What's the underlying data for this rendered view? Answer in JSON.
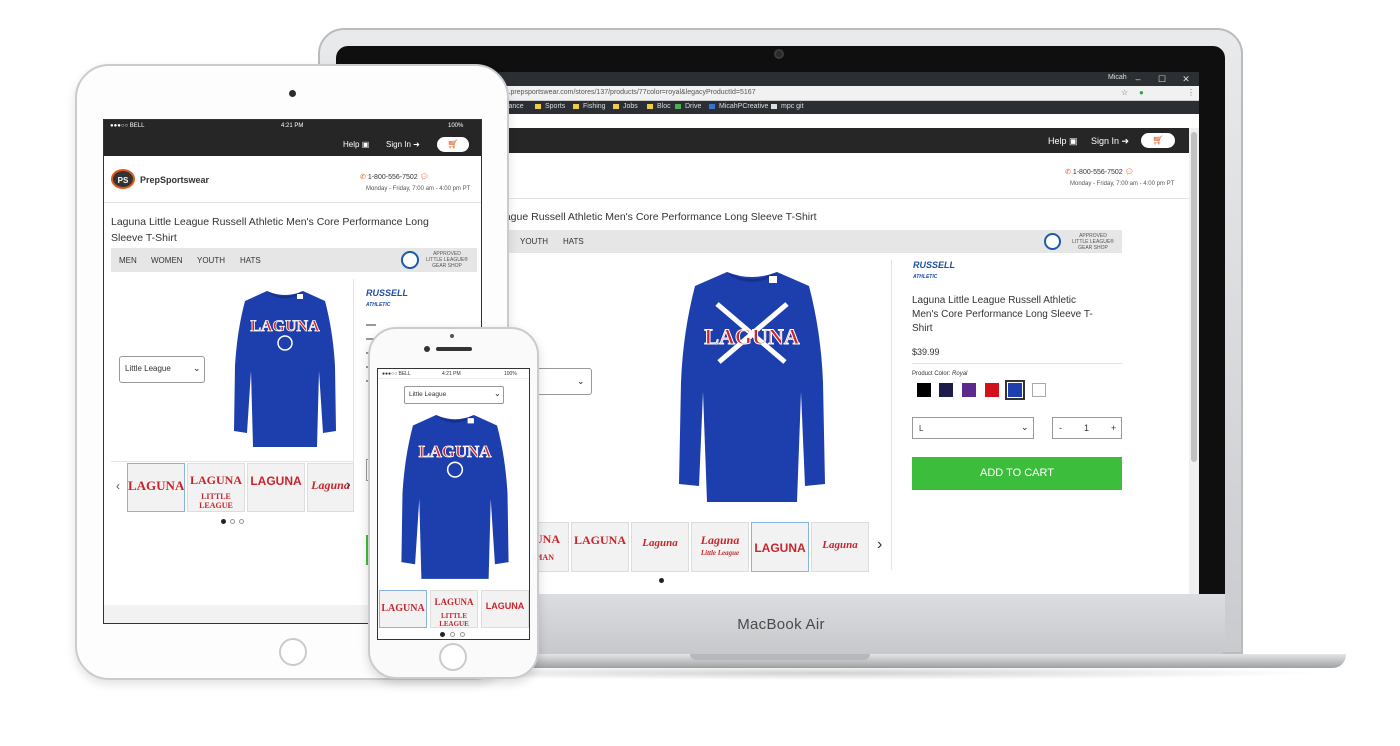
{
  "laptop": {
    "brand_text": "MacBook Air",
    "window": {
      "user": "Micah",
      "minimize": "–",
      "maximize": "☐",
      "close": "✕"
    },
    "address": "s.prepsportswear.com/stores/137/products/77color=royal&legacyProductId=5167",
    "bookmarks": [
      "elance",
      "Sports",
      "Fishing",
      "Jobs",
      "Bloc",
      "Drive",
      "MicahPCreative",
      "mpc git"
    ],
    "site": {
      "help": "Help",
      "sign_in": "Sign In",
      "phone": "1-800-556-7502",
      "hours": "Monday - Friday, 7:00 am - 4:00 pm PT",
      "page_title": "eague Russell Athletic Men's Core Performance Long Sleeve T-Shirt",
      "nav": [
        "YOUTH",
        "HATS"
      ],
      "badge": [
        "APPROVED",
        "LITTLE LEAGUE®",
        "GEAR SHOP"
      ],
      "brand_logo": "RUSSELL",
      "brand_logo_sub": "ATHLETIC",
      "product_title": [
        "Laguna Little League Russell Athletic",
        "Men's Core Performance Long Sleeve T-",
        "Shirt"
      ],
      "price": "$39.99",
      "color_label": "Product Color:",
      "color_value": "Royal",
      "swatches": [
        "#000000",
        "#1b1c4a",
        "#5b2a8c",
        "#d1121b",
        "#1e3fae",
        "#ffffff"
      ],
      "size": "L",
      "qty_minus": "-",
      "qty_value": "1",
      "qty_plus": "+",
      "add_to_cart": "ADD TO CART",
      "shirt_text": "LAGUNA",
      "thumbs": [
        "LAGUNA",
        "LAGUNA",
        "Laguna",
        "Laguna",
        "LAGUNA",
        "Laguna"
      ],
      "thumb_subs": [
        "BASEMAN",
        "",
        "",
        "Little League",
        "",
        ""
      ],
      "next_arrow": "›"
    }
  },
  "tablet": {
    "status": {
      "carrier": "●●●○○ BELL",
      "time": "4:21 PM",
      "battery": "100%"
    },
    "help": "Help",
    "sign_in": "Sign In",
    "logo_text": "PrepSportswear",
    "logo_mark": "PS",
    "phone": "1-800-556-7502",
    "hours": "Monday - Friday, 7:00 am - 4:00 pm PT",
    "page_title_line1": "Laguna Little League Russell Athletic Men's Core Performance Long",
    "page_title_line2": "Sleeve T-Shirt",
    "nav": [
      "MEN",
      "WOMEN",
      "YOUTH",
      "HATS"
    ],
    "badge": [
      "APPROVED",
      "LITTLE LEAGUE®",
      "GEAR SHOP"
    ],
    "select_value": "Little League",
    "brand_logo": "RUSSELL",
    "brand_logo_sub": "ATHLETIC",
    "shirt_text": "LAGUNA",
    "thumbs": [
      "LAGUNA",
      "LAGUNA",
      "LAGUNA",
      "Laguna"
    ],
    "thumb_subs": [
      "",
      "LITTLE LEAGUE",
      "",
      ""
    ],
    "prev_arrow": "‹",
    "next_arrow": "›"
  },
  "phone": {
    "status": {
      "carrier": "●●●○○ BELL",
      "time": "4:21 PM",
      "battery": "100%"
    },
    "select_value": "Little League",
    "shirt_text": "LAGUNA",
    "thumbs": [
      "LAGUNA",
      "LAGUNA",
      "LAGUNA"
    ],
    "thumb_subs": [
      "",
      "LITTLE LEAGUE",
      ""
    ]
  },
  "colors": {
    "accent_orange": "#e05a1c",
    "cart_green": "#3cbe3c",
    "shirt_blue": "#1d3fae",
    "logo_red": "#c8262c"
  }
}
